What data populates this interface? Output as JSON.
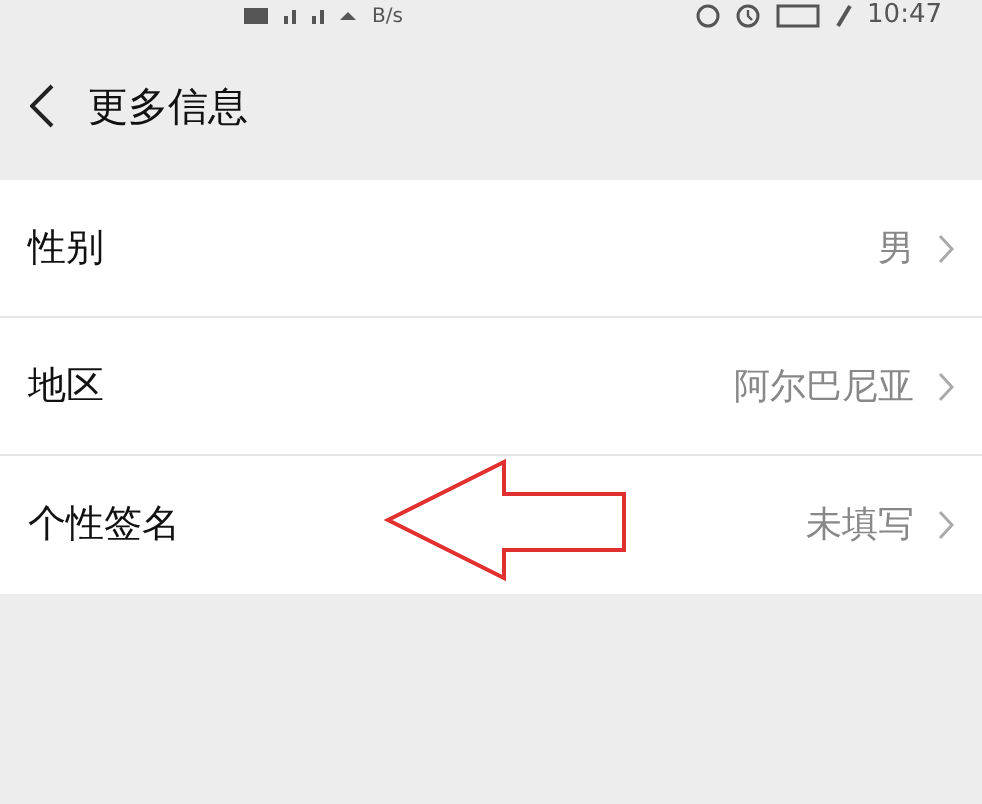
{
  "status_bar": {
    "speed": "B/s",
    "time": "10:47"
  },
  "header": {
    "title": "更多信息"
  },
  "rows": [
    {
      "label": "性别",
      "value": "男"
    },
    {
      "label": "地区",
      "value": "阿尔巴尼亚"
    },
    {
      "label": "个性签名",
      "value": "未填写"
    }
  ]
}
